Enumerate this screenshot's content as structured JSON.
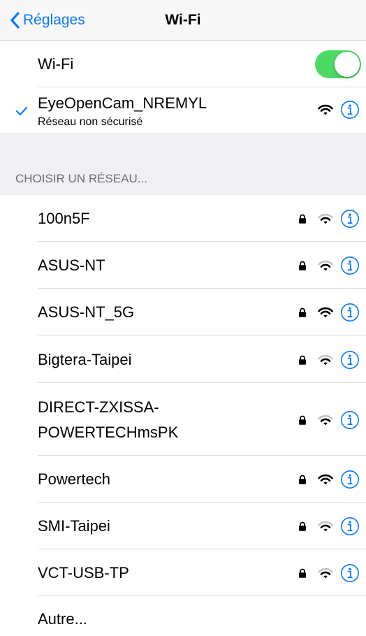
{
  "nav": {
    "back_label": "Réglages",
    "title": "Wi-Fi"
  },
  "wifi_toggle": {
    "label": "Wi-Fi",
    "on": true
  },
  "connected": {
    "ssid": "EyeOpenCam_NREMYL",
    "subtitle": "Réseau non sécurisé",
    "icon": "wifi-icon"
  },
  "section_header": "CHOISIR UN RÉSEAU...",
  "networks": [
    {
      "ssid": "100n5F",
      "locked": true
    },
    {
      "ssid": "ASUS-NT",
      "locked": true
    },
    {
      "ssid": "ASUS-NT_5G",
      "locked": true
    },
    {
      "ssid": "Bigtera-Taipei",
      "locked": true
    },
    {
      "ssid_line1": "DIRECT-ZXISSA-",
      "ssid_line2": "POWERTECHmsPK",
      "locked": true
    },
    {
      "ssid": "Powertech",
      "locked": true
    },
    {
      "ssid": "SMI-Taipei",
      "locked": true
    },
    {
      "ssid": "VCT-USB-TP",
      "locked": true
    }
  ],
  "other_label": "Autre...",
  "colors": {
    "accent": "#0a7aff",
    "toggle_on": "#4cd964",
    "group_bg": "#efeff4",
    "header_text": "#6d6d72"
  },
  "icons": [
    "chevron-left-icon",
    "checkmark-icon",
    "wifi-icon",
    "lock-icon",
    "info-icon"
  ]
}
